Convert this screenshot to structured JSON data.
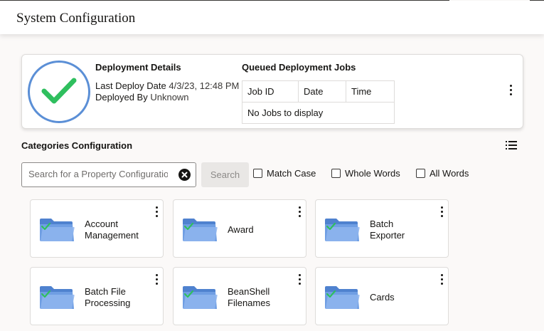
{
  "header": {
    "title": "System Configuration"
  },
  "deployment": {
    "status_icon": "check-circle-icon",
    "status_color": "#2fbf5e",
    "ring_color": "#5b8fd6",
    "details_title": "Deployment Details",
    "last_deploy_label": "Last Deploy Date",
    "last_deploy_value": "4/3/23, 12:48 PM",
    "deployed_by_label": "Deployed By",
    "deployed_by_value": "Unknown",
    "queued_title": "Queued Deployment Jobs",
    "columns": [
      "Job ID",
      "Date",
      "Time"
    ],
    "empty_text": "No Jobs to display",
    "menu_icon": "kebab-icon"
  },
  "categories": {
    "title": "Categories Configuration",
    "view_icon": "list-view-icon",
    "search": {
      "placeholder": "Search for a Property Configuration",
      "value": ""
    },
    "search_button": "Search",
    "options": [
      "Match Case",
      "Whole Words",
      "All Words"
    ],
    "tiles": [
      {
        "line1": "Account",
        "line2": "Management",
        "icon": "folder-check-icon"
      },
      {
        "line1": "Award",
        "line2": "",
        "icon": "folder-check-icon"
      },
      {
        "line1": "Batch",
        "line2": "Exporter",
        "icon": "folder-check-icon"
      },
      {
        "line1": "Batch File",
        "line2": "Processing",
        "icon": "folder-check-icon"
      },
      {
        "line1": "BeanShell",
        "line2": "Filenames",
        "icon": "folder-check-icon"
      },
      {
        "line1": "Cards",
        "line2": "",
        "icon": "folder-check-icon"
      }
    ]
  },
  "colors": {
    "accent": "#5b8fd6",
    "success": "#2fbf5e",
    "folder": "#6f9ee3"
  }
}
